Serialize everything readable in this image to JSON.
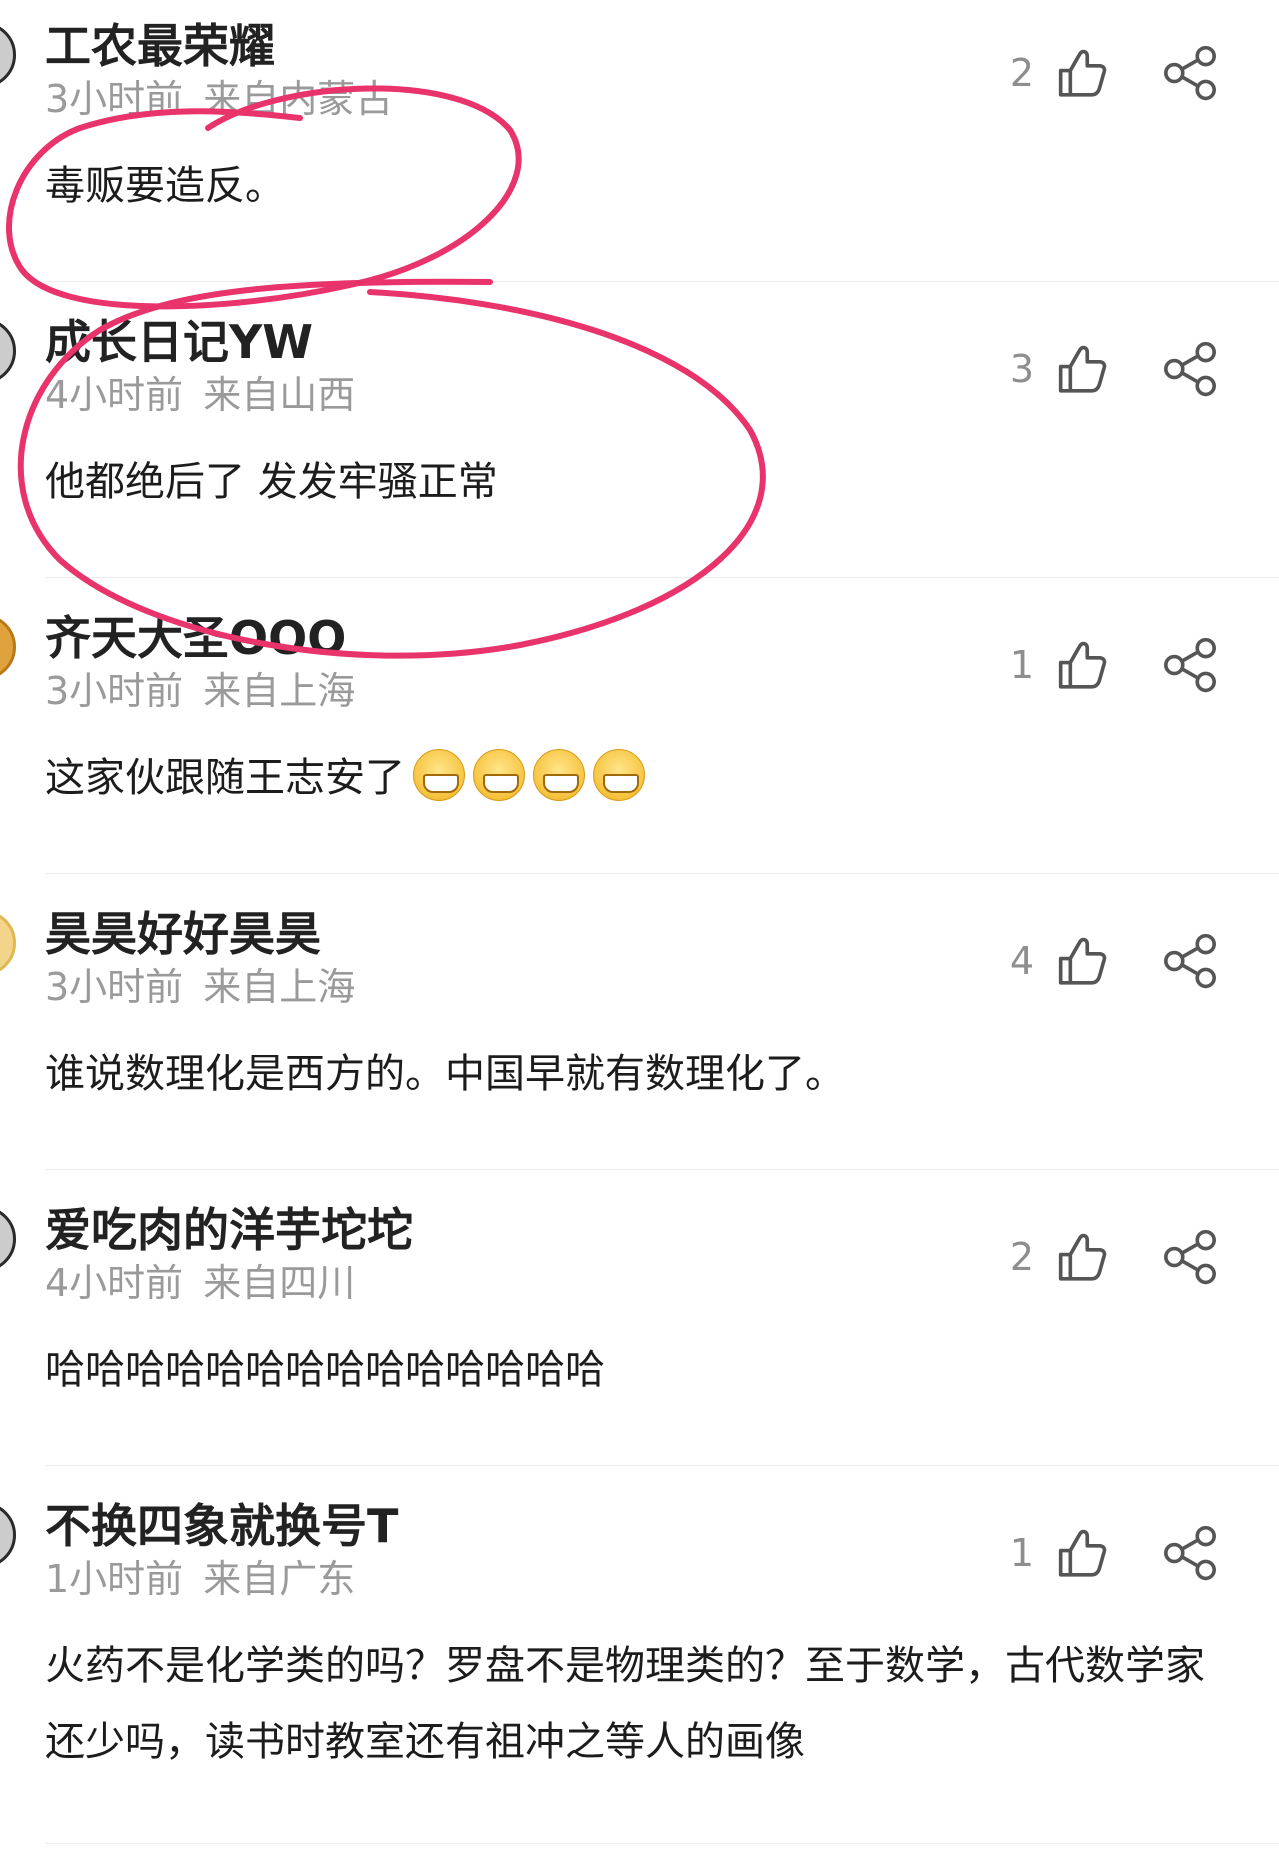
{
  "comments": [
    {
      "username": "工农最荣耀",
      "time": "3小时前",
      "location": "来自内蒙古",
      "text": "毒贩要造反。",
      "likes": "2",
      "emoji_count": 0
    },
    {
      "username": "成长日记YW",
      "time": "4小时前",
      "location": "来自山西",
      "text": "他都绝后了 发发牢骚正常",
      "likes": "3",
      "emoji_count": 0
    },
    {
      "username": "齐天大圣OOO",
      "time": "3小时前",
      "location": "来自上海",
      "text": "这家伙跟随王志安了",
      "likes": "1",
      "emoji_count": 4,
      "emoji_name": "grin-emoji"
    },
    {
      "username": "昊昊好好昊昊",
      "time": "3小时前",
      "location": "来自上海",
      "text": "谁说数理化是西方的。中国早就有数理化了。",
      "likes": "4",
      "emoji_count": 0
    },
    {
      "username": "爱吃肉的洋芋坨坨",
      "time": "4小时前",
      "location": "来自四川",
      "text": "哈哈哈哈哈哈哈哈哈哈哈哈哈哈",
      "likes": "2",
      "emoji_count": 0
    },
    {
      "username": "不换四象就换号T",
      "time": "1小时前",
      "location": "来自广东",
      "text": "火药不是化学类的吗？罗盘不是物理类的？至于数学，古代数学家还少吗，读书时教室还有祖冲之等人的画像",
      "likes": "1",
      "emoji_count": 0
    }
  ],
  "icons": {
    "like": "thumbs-up-icon",
    "share": "share-icon"
  },
  "colors": {
    "annotation_circle": "#e8336b",
    "meta_text": "#9a9a9a",
    "username_text": "#222222"
  }
}
